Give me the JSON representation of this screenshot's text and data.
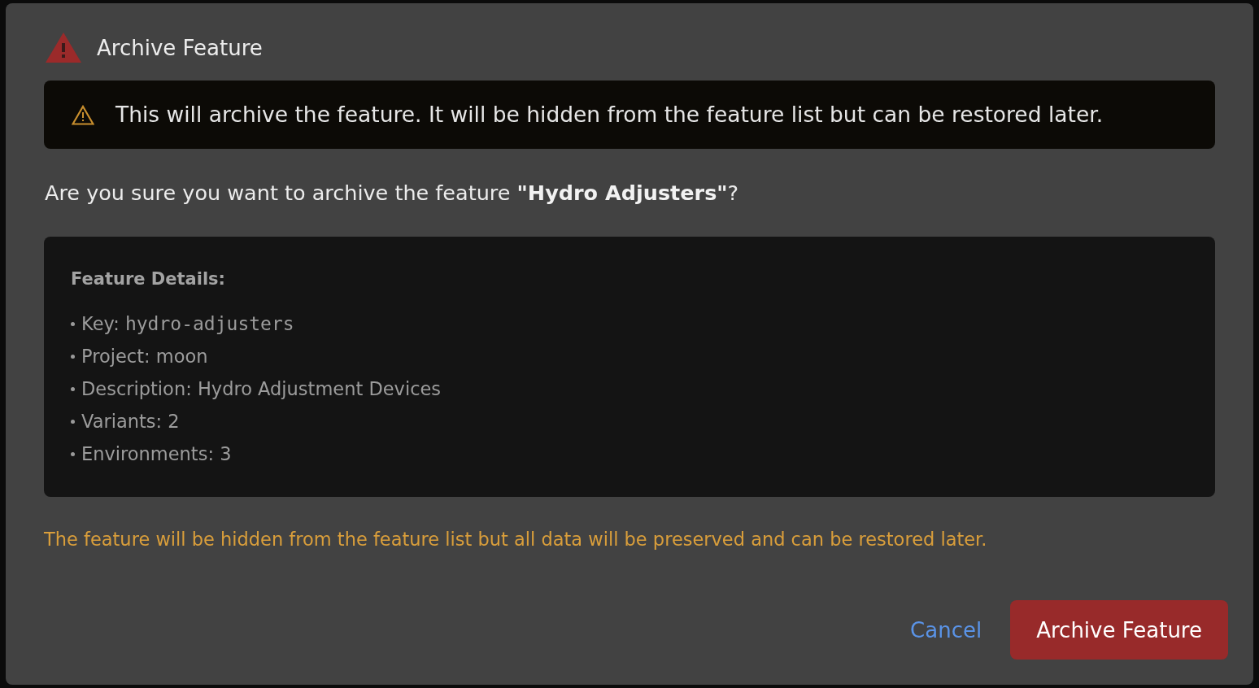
{
  "dialog": {
    "title": "Archive Feature",
    "alert": {
      "text": "This will archive the feature. It will be hidden from the feature list but can be restored later."
    },
    "question": "Are you sure you want to archive the feature **\"Hydro Adjusters\"**?",
    "details": {
      "heading": "Feature Details:",
      "items": [
        {
          "label": "Key:",
          "value": "hydro-adjusters",
          "kind": "code"
        },
        {
          "label": "Project:",
          "value": "moon",
          "kind": "text"
        },
        {
          "label": "Description:",
          "value": "Hydro Adjustment Devices",
          "kind": "text"
        },
        {
          "label": "Variants:",
          "value": "2",
          "kind": "text"
        },
        {
          "label": "Environments:",
          "value": "3",
          "kind": "text"
        }
      ]
    },
    "note": "The feature will be hidden from the feature list but all data will be preserved and can be restored later.",
    "buttons": [
      {
        "label": "Cancel",
        "kind": "link"
      },
      {
        "label": "Archive Feature",
        "kind": "danger"
      }
    ]
  }
}
